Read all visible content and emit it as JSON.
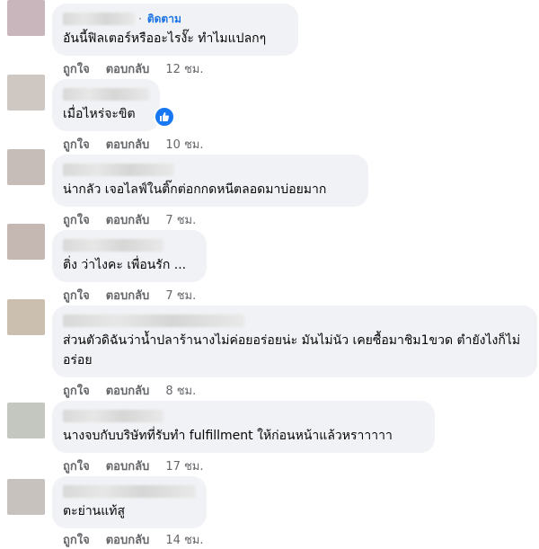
{
  "colors": {
    "bubble": "#f0f2f5",
    "link": "#1b74e4",
    "meta": "#65676b",
    "like": "#1877f2"
  },
  "comments": [
    {
      "text": "อันนี้ฟิลเตอร์หรืออะไรงั๊ะ ทำไมแปลกๆ",
      "follow": "ติดตาม",
      "like": "ถูกใจ",
      "reply": "ตอบกลับ",
      "time": "12 ชม."
    },
    {
      "text": "เมื่อไหร่จะขิต",
      "like": "ถูกใจ",
      "reply": "ตอบกลับ",
      "time": "10 ชม.",
      "reaction_icon": "thumbs-up-icon"
    },
    {
      "text": "น่ากลัว เจอไลฟ์ในติ๊กต่อกกดหนีตลอดมาบ่อยมาก",
      "like": "ถูกใจ",
      "reply": "ตอบกลับ",
      "time": "7 ชม."
    },
    {
      "text": "ติ่ง ว่าไงคะ เพื่อนรัก ...",
      "like": "ถูกใจ",
      "reply": "ตอบกลับ",
      "time": "7 ชม."
    },
    {
      "text": "ส่วนตัวดิฉันว่าน้ำปลาร้านางไม่ค่อยอร่อยน่ะ มันไม่นัว เคยซื้อมาชิม1ขวด ตำยังไงก็ไม่อร่อย",
      "like": "ถูกใจ",
      "reply": "ตอบกลับ",
      "time": "8 ชม."
    },
    {
      "text": "นางจบกับบริษัทที่รับทำ fulfillment ให้ก่อนหน้าแล้วหราาาาา",
      "like": "ถูกใจ",
      "reply": "ตอบกลับ",
      "time": "17 ชม."
    },
    {
      "text": "ตะย่านแท้สู",
      "like": "ถูกใจ",
      "reply": "ตอบกลับ",
      "time": "14 ชม."
    }
  ]
}
